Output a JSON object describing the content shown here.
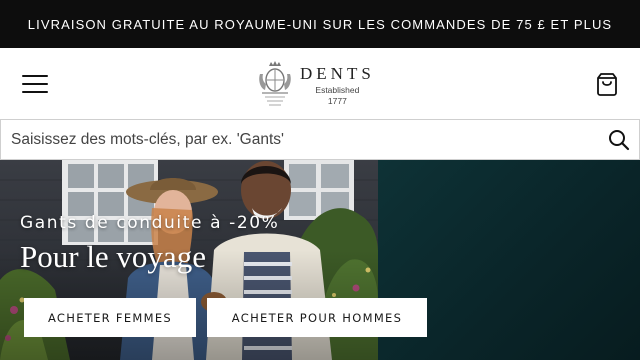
{
  "promo": {
    "text": "LIVRAISON GRATUITE AU ROYAUME-UNI SUR LES COMMANDES DE 75 £ ET PLUS"
  },
  "header": {
    "menu_icon": "hamburger-menu-icon",
    "logo": {
      "name": "DENTS",
      "established": "Established",
      "year": "1777",
      "crest_icon": "royal-crest-icon"
    },
    "bag_icon": "shopping-bag-icon"
  },
  "search": {
    "placeholder": "Saisissez des mots-clés, par ex. 'Gants'",
    "value": "",
    "icon": "search-icon"
  },
  "hero": {
    "subtitle": "Gants de conduite à -20%",
    "title": "Pour le voyage",
    "buttons": {
      "women": "ACHETER FEMMES",
      "men": "ACHETER POUR HOMMES"
    },
    "photo": "couple-in-garden-photo"
  },
  "colors": {
    "promo_bg": "#0d0d0d",
    "hero_teal": "#0e3236",
    "text": "#1a1a1a"
  }
}
